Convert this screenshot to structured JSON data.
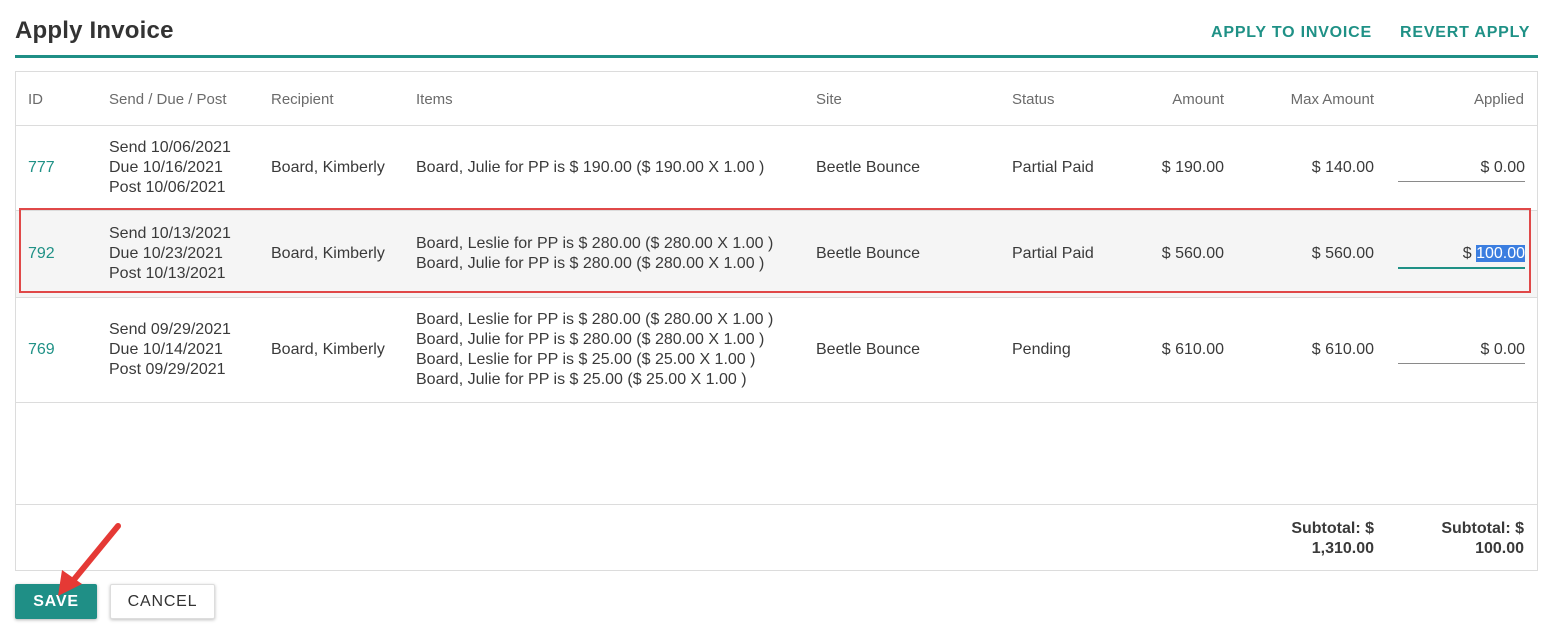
{
  "page": {
    "title": "Apply Invoice",
    "actions": {
      "apply": "APPLY TO INVOICE",
      "revert": "REVERT APPLY"
    }
  },
  "table": {
    "columns": [
      "ID",
      "Send / Due / Post",
      "Recipient",
      "Items",
      "Site",
      "Status",
      "Amount",
      "Max Amount",
      "Applied"
    ],
    "rows": [
      {
        "id": "777",
        "send": "Send 10/06/2021",
        "due": "Due 10/16/2021",
        "post": "Post 10/06/2021",
        "recipient": "Board, Kimberly",
        "items": [
          "Board, Julie for PP is $ 190.00 ($ 190.00 X 1.00 )"
        ],
        "site": "Beetle Bounce",
        "status": "Partial Paid",
        "amount": "$ 190.00",
        "max_amount": "$ 140.00",
        "applied_prefix": "$ ",
        "applied_value": "0.00"
      },
      {
        "id": "792",
        "send": "Send 10/13/2021",
        "due": "Due 10/23/2021",
        "post": "Post 10/13/2021",
        "recipient": "Board, Kimberly",
        "items": [
          "Board, Leslie for PP is $ 280.00 ($ 280.00 X 1.00 )",
          "Board, Julie for PP is $ 280.00 ($ 280.00 X 1.00 )"
        ],
        "site": "Beetle Bounce",
        "status": "Partial Paid",
        "amount": "$ 560.00",
        "max_amount": "$ 560.00",
        "applied_prefix": "$ ",
        "applied_value": "100.00"
      },
      {
        "id": "769",
        "send": "Send 09/29/2021",
        "due": "Due 10/14/2021",
        "post": "Post 09/29/2021",
        "recipient": "Board, Kimberly",
        "items": [
          "Board, Leslie for PP is $ 280.00 ($ 280.00 X 1.00 )",
          "Board, Julie for PP is $ 280.00 ($ 280.00 X 1.00 )",
          "Board, Leslie for PP is $ 25.00 ($ 25.00 X 1.00 )",
          "Board, Julie for PP is $ 25.00 ($ 25.00 X 1.00 )"
        ],
        "site": "Beetle Bounce",
        "status": "Pending",
        "amount": "$ 610.00",
        "max_amount": "$ 610.00",
        "applied_prefix": "$ ",
        "applied_value": "0.00"
      }
    ],
    "subtotal_max": {
      "label": "Subtotal: $",
      "value": "1,310.00"
    },
    "subtotal_applied": {
      "label": "Subtotal: $",
      "value": "100.00"
    }
  },
  "buttons": {
    "save": "SAVE",
    "cancel": "CANCEL"
  },
  "colors": {
    "accent": "#1f8f86",
    "highlight": "#e04848",
    "selection": "#3b7ee0"
  }
}
